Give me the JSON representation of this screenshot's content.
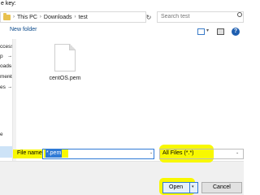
{
  "window": {
    "title": "e key:"
  },
  "address": {
    "crumbs": [
      "This PC",
      "Downloads",
      "test"
    ],
    "separator": "›",
    "dropdown": "⌄",
    "refresh": "↻"
  },
  "search": {
    "placeholder": "Search test",
    "value": ""
  },
  "toolbar": {
    "new_folder_label": "New folder",
    "view_dropdown": "▾",
    "help": "?"
  },
  "nav": {
    "items": [
      {
        "label": "ccess",
        "pinned": false
      },
      {
        "label": "p",
        "pinned": true
      },
      {
        "label": "oads",
        "pinned": true
      },
      {
        "label": "ments",
        "pinned": true
      },
      {
        "label": "es",
        "pinned": true
      },
      {
        "label": "",
        "pinned": false
      },
      {
        "label": "",
        "pinned": false
      },
      {
        "label": "",
        "pinned": false
      },
      {
        "label": "e",
        "pinned": false
      }
    ],
    "pin_glyph": "⊸"
  },
  "files": [
    {
      "name": "centOS.pem",
      "icon": "file-icon"
    }
  ],
  "footer": {
    "filename_label": "File name:",
    "filename_value": "*.pem",
    "filename_dropdown": "⌄",
    "filter_value": "All Files (*.*)",
    "filter_dropdown": "⌄",
    "open_label": "Open",
    "open_arrow": "▾",
    "cancel_label": "Cancel"
  },
  "colors": {
    "highlight": "#f8f800",
    "accent": "#2f7ad6",
    "link": "#0b4a8b"
  }
}
